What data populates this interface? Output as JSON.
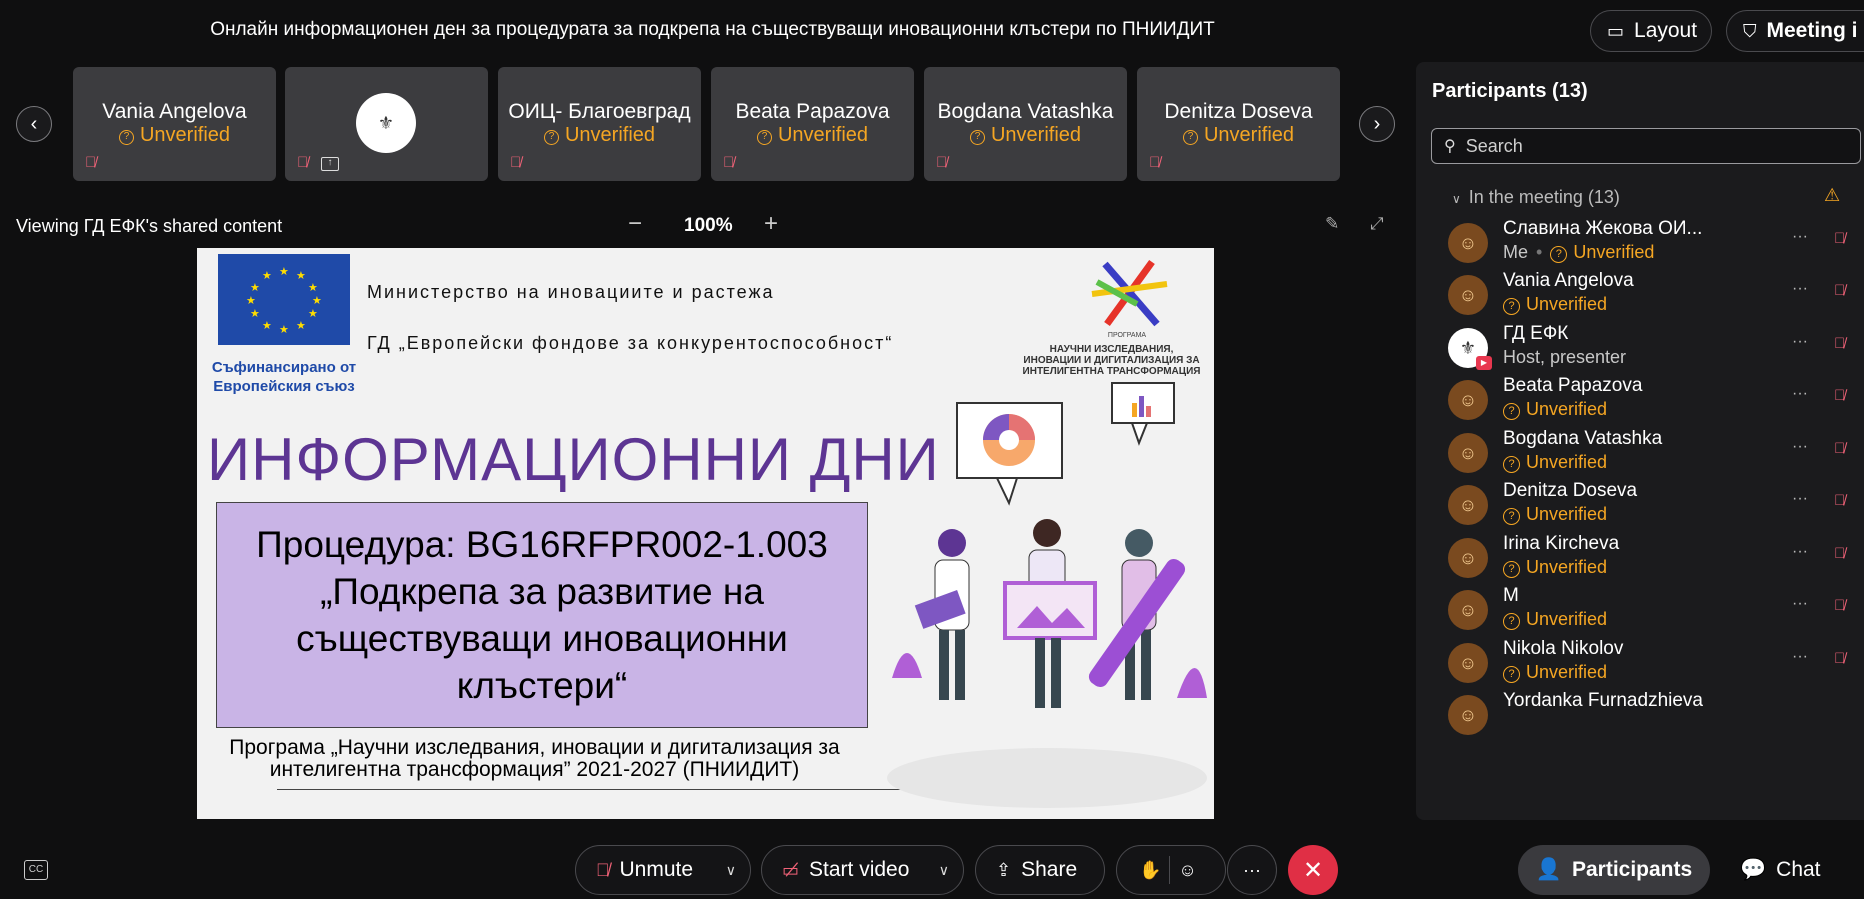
{
  "meeting_title": "Онлайн информационен ден за процедурата за подкрепа на съществуващи иновационни клъстери по ПНИИДИТ",
  "top_buttons": {
    "layout_label": "Layout",
    "meeting_info_label": "Meeting i"
  },
  "strip": {
    "tiles": [
      {
        "name": "Vania Angelova",
        "status": "Unverified"
      },
      {
        "name": "",
        "status": ""
      },
      {
        "name": "ОИЦ- Благоевград",
        "status": "Unverified"
      },
      {
        "name": "Beata Papazova",
        "status": "Unverified"
      },
      {
        "name": "Bogdana Vatashka",
        "status": "Unverified"
      },
      {
        "name": "Denitza Doseva",
        "status": "Unverified"
      }
    ]
  },
  "share_bar": {
    "viewing_text": "Viewing ГД ЕФК's shared content",
    "zoom": "100%"
  },
  "slide": {
    "eu_caption_line1": "Съфинансирано от",
    "eu_caption_line2": "Европейския съюз",
    "ministry": "Министерство на иновациите и растежа",
    "directorate": "ГД „Европейски фондове за конкурентоспособност“",
    "program_logo_small": "ПРОГРАМА",
    "program_logo_line1": "НАУЧНИ ИЗСЛЕДВАНИЯ,",
    "program_logo_line2": "ИНОВАЦИИ И ДИГИТАЛИЗАЦИЯ ЗА",
    "program_logo_line3": "ИНТЕЛИГЕНТНА ТРАНСФОРМАЦИЯ",
    "big_title": "ИНФОРМАЦИОННИ ДНИ",
    "procedure_line1": "Процедура: BG16RFPR002-1.003",
    "procedure_line2": "„Подкрепа за развитие на",
    "procedure_line3": "съществуващи иновационни",
    "procedure_line4": "клъстери“",
    "program_line1": "Програма „Научни изследвания, иновации и дигитализация за",
    "program_line2": "интелигентна трансформация” 2021-2027 (ПНИИДИТ)"
  },
  "panel": {
    "title": "Participants (13)",
    "search_placeholder": "Search",
    "group_label": "In the meeting (13)",
    "participants": [
      {
        "name": "Славина Жекова ОИ...",
        "me": "Me",
        "status": "Unverified"
      },
      {
        "name": "Vania Angelova",
        "status": "Unverified"
      },
      {
        "name": "ГД ЕФК",
        "role": "Host, presenter"
      },
      {
        "name": "Beata Papazova",
        "status": "Unverified"
      },
      {
        "name": "Bogdana Vatashka",
        "status": "Unverified"
      },
      {
        "name": "Denitza Doseva",
        "status": "Unverified"
      },
      {
        "name": "Irina Kircheva",
        "status": "Unverified"
      },
      {
        "name": "M",
        "status": "Unverified"
      },
      {
        "name": "Nikola Nikolov",
        "status": "Unverified"
      },
      {
        "name": "Yordanka Furnadzhieva",
        "status": ""
      }
    ]
  },
  "toolbar": {
    "unmute_label": "Unmute",
    "start_video_label": "Start video",
    "share_label": "Share",
    "participants_label": "Participants",
    "chat_label": "Chat"
  },
  "colors": {
    "accent_orange": "#f5a623",
    "mute_red": "#f06277",
    "leave_red": "#e02f45",
    "slide_title_purple": "#5d3593",
    "procedure_box": "#c9b4e6"
  }
}
